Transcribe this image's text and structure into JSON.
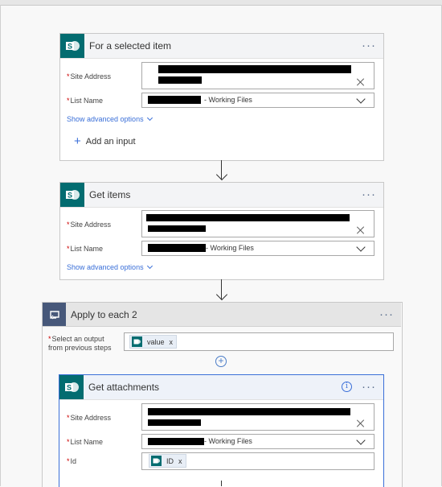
{
  "card1": {
    "title": "For a selected item",
    "site_address_label": "Site Address",
    "list_name_label": "List Name",
    "list_name_value": "- Working Files",
    "advanced_label": "Show advanced options",
    "add_input_label": "Add an input",
    "menu": "···"
  },
  "card2": {
    "title": "Get items",
    "site_address_label": "Site Address",
    "list_name_label": "List Name",
    "list_name_value": "- Working Files",
    "advanced_label": "Show advanced options",
    "menu": "···"
  },
  "loop": {
    "title": "Apply to each 2",
    "select_label_line1": "Select an output",
    "select_label_line2": "from previous steps",
    "token_label": "value",
    "token_remove": "x",
    "add_step": "+",
    "menu": "···"
  },
  "card3": {
    "title": "Get attachments",
    "site_address_label": "Site Address",
    "list_name_label": "List Name",
    "list_name_value": "- Working Files",
    "id_label": "Id",
    "id_token_label": "ID",
    "id_token_remove": "x",
    "info": "i",
    "menu": "···"
  },
  "required_mark": "*",
  "colors": {
    "sharepoint": "#036c70",
    "loop": "#47587a",
    "link": "#3a6fd8",
    "required": "#cc0000"
  }
}
